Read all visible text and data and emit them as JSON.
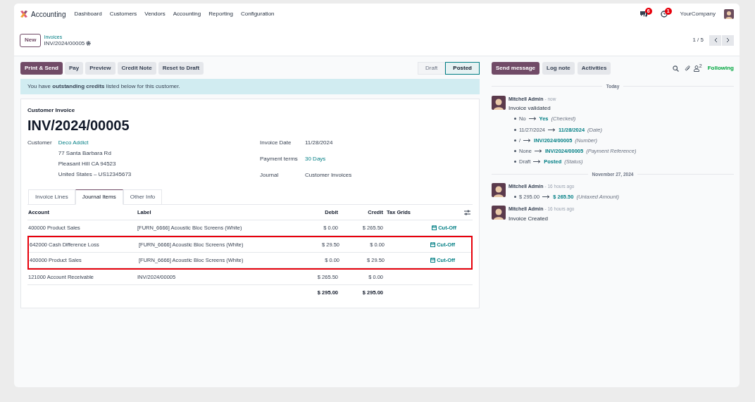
{
  "app": {
    "name": "Accounting",
    "menu": [
      "Dashboard",
      "Customers",
      "Vendors",
      "Accounting",
      "Reporting",
      "Configuration"
    ]
  },
  "systray": {
    "messages_badge": "6",
    "activities_badge": "1",
    "company": "YourCompany"
  },
  "breadcrumb": {
    "new_button": "New",
    "parent": "Invoices",
    "current": "INV/2024/00005"
  },
  "pager": {
    "text": "1 / 5"
  },
  "actions": [
    {
      "label": "Print & Send",
      "kind": "primary"
    },
    {
      "label": "Pay",
      "kind": "secondary"
    },
    {
      "label": "Preview",
      "kind": "secondary"
    },
    {
      "label": "Credit Note",
      "kind": "secondary"
    },
    {
      "label": "Reset to Draft",
      "kind": "secondary"
    }
  ],
  "status_stages": [
    {
      "label": "Draft",
      "selected": false
    },
    {
      "label": "Posted",
      "selected": true
    }
  ],
  "chatter_buttons": [
    {
      "label": "Send message",
      "kind": "primary"
    },
    {
      "label": "Log note",
      "kind": "secondary"
    },
    {
      "label": "Activities",
      "kind": "secondary"
    }
  ],
  "followers": {
    "count": "2",
    "following": "Following"
  },
  "alert": "You have **outstanding credits** listed below for this customer.",
  "invoice": {
    "type": "Customer Invoice",
    "number": "INV/2024/00005",
    "customer_label": "Customer",
    "customer": "Deco Addict",
    "address": [
      "77 Santa Barbara Rd",
      "Pleasant Hill CA 94523",
      "United States – US12345673"
    ],
    "fields": [
      {
        "label": "Invoice Date",
        "value": "11/28/2024",
        "link": false
      },
      {
        "label": "Payment terms",
        "value": "30 Days",
        "link": true
      },
      {
        "label": "Journal",
        "value": "Customer Invoices",
        "link": false
      }
    ]
  },
  "tabs": [
    {
      "label": "Invoice Lines",
      "selected": false
    },
    {
      "label": "Journal Items",
      "selected": true
    },
    {
      "label": "Other Info",
      "selected": false
    }
  ],
  "table": {
    "columns": [
      "Account",
      "Label",
      "Debit",
      "Credit",
      "Tax Grids"
    ],
    "rows": [
      {
        "account": "400000 Product Sales",
        "label": "[FURN_6666] Acoustic Bloc Screens (White)",
        "debit": "$ 0.00",
        "credit": "$ 265.50",
        "cutoff": "Cut-Off",
        "highlighted": false
      },
      {
        "account": "642000 Cash Difference Loss",
        "label": "[FURN_6666] Acoustic Bloc Screens (White)",
        "debit": "$ 29.50",
        "credit": "$ 0.00",
        "cutoff": "Cut-Off",
        "highlighted": true
      },
      {
        "account": "400000 Product Sales",
        "label": "[FURN_6666] Acoustic Bloc Screens (White)",
        "debit": "$ 0.00",
        "credit": "$ 29.50",
        "cutoff": "Cut-Off",
        "highlighted": true
      },
      {
        "account": "121000 Account Receivable",
        "label": "INV/2024/00005",
        "debit": "$ 265.50",
        "credit": "$ 0.00",
        "highlighted": false
      }
    ],
    "totals": {
      "debit": "$ 295.00",
      "credit": "$ 295.00"
    }
  },
  "chatter": [
    {
      "kind": "separator",
      "label": "Today"
    },
    {
      "kind": "message",
      "author": "Mitchell Admin",
      "time": "- now",
      "body": "Invoice validated",
      "changes": [
        {
          "from": "No",
          "to": "Yes",
          "field": "(Checked)"
        },
        {
          "from": "11/27/2024",
          "to": "11/28/2024",
          "field": "(Date)"
        },
        {
          "from": "/",
          "to": "INV/2024/00005",
          "field": "(Number)"
        },
        {
          "from": "None",
          "to": "INV/2024/00005",
          "field": "(Payment Reference)"
        },
        {
          "from": "Draft",
          "to": "Posted",
          "field": "(Status)"
        }
      ]
    },
    {
      "kind": "separator",
      "label": "November 27, 2024"
    },
    {
      "kind": "message",
      "author": "Mitchell Admin",
      "time": "- 16 hours ago",
      "changes": [
        {
          "from": "$ 295.00",
          "to": "$ 265.50",
          "field": "(Untaxed Amount)"
        }
      ]
    },
    {
      "kind": "message",
      "author": "Mitchell Admin",
      "time": "- 16 hours ago",
      "body": "Invoice Created"
    }
  ]
}
